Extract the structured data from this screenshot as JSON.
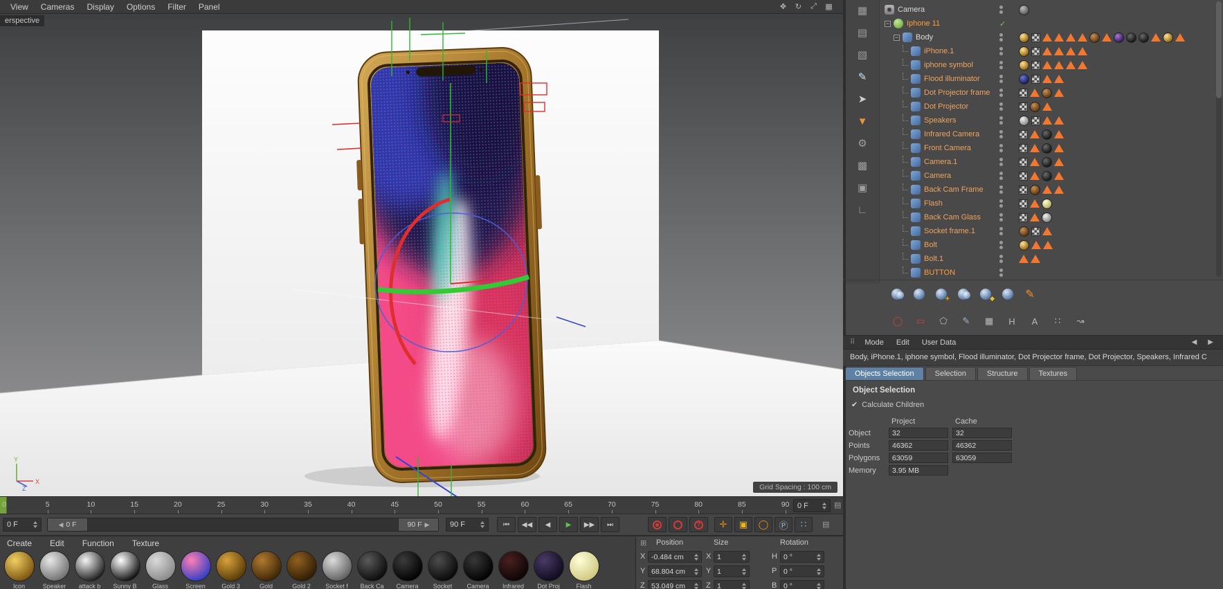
{
  "colors": {
    "accent_orange": "#f08a1a",
    "selected_text_orange": "#ff9d3c",
    "tab_active_blue": "#5e81a4",
    "play_green": "#5ec14e",
    "record_red": "#d23b3b",
    "gizmo_green": "#35c935",
    "gizmo_red": "#df2e2e",
    "gizmo_blue": "#4d5dd8"
  },
  "menubar": {
    "items": [
      "View",
      "Cameras",
      "Display",
      "Options",
      "Filter",
      "Panel"
    ],
    "viewport_controls": [
      {
        "name": "pan-view-icon",
        "glyph": "✥"
      },
      {
        "name": "orbit-view-icon",
        "glyph": "↻"
      },
      {
        "name": "zoom-view-icon",
        "glyph": "⤢"
      },
      {
        "name": "toggle-view-icon",
        "glyph": "▦"
      }
    ]
  },
  "viewport": {
    "view_label": "erspective",
    "grid_spacing_label": "Grid Spacing : 100 cm",
    "axis_x": "X",
    "axis_y": "Y",
    "axis_z": "Z"
  },
  "timeline": {
    "ruler_ticks": [
      "0",
      "5",
      "10",
      "15",
      "20",
      "25",
      "30",
      "35",
      "40",
      "45",
      "50",
      "55",
      "60",
      "65",
      "70",
      "75",
      "80",
      "85",
      "90"
    ],
    "current_frame_field": "0 F",
    "frame_combo": "0 F",
    "range_start_label": "0 F",
    "range_end_label": "90 F",
    "end_frame_field": "90 F",
    "transport_buttons": [
      {
        "name": "goto-start-button",
        "glyph": "⏮"
      },
      {
        "name": "prev-key-button",
        "glyph": "◀◀"
      },
      {
        "name": "prev-frame-button",
        "glyph": "◀"
      },
      {
        "name": "play-button",
        "glyph": "▶",
        "color": "#5ec14e"
      },
      {
        "name": "next-frame-button",
        "glyph": "▶▶"
      },
      {
        "name": "goto-end-button",
        "glyph": "⏭"
      }
    ],
    "record_buttons": [
      {
        "name": "record-keyframe-button",
        "style": "dot"
      },
      {
        "name": "autokey-button",
        "style": "ring"
      },
      {
        "name": "keyframe-selection-button",
        "style": "question"
      }
    ],
    "record_toggles": [
      {
        "name": "record-position-toggle",
        "glyph": "✛",
        "color": "#f08a1a"
      },
      {
        "name": "record-scale-toggle",
        "glyph": "▣",
        "color": "#f0b31a"
      },
      {
        "name": "record-rotation-toggle",
        "glyph": "◯",
        "color": "#f08a1a"
      },
      {
        "name": "record-parameter-toggle",
        "glyph": "Ⓟ",
        "color": "#9fb6d8"
      },
      {
        "name": "record-pla-toggle",
        "glyph": "∷",
        "color": "#8fa8e8"
      }
    ]
  },
  "materials": {
    "menu_items": [
      "Create",
      "Edit",
      "Function",
      "Texture"
    ],
    "items": [
      {
        "name": "Icon",
        "c1": "#f2cf63",
        "c2": "#7a5310"
      },
      {
        "name": "Speaker",
        "c1": "#e8e8e8",
        "c2": "#6f6f6f"
      },
      {
        "name": "attack b",
        "c1": "#f5f5f5",
        "c2": "#1c1c1c"
      },
      {
        "name": "Sunny B",
        "c1": "#ffffff",
        "c2": "#0d0d0d"
      },
      {
        "name": "Glass",
        "c1": "#d9d9d9",
        "c2": "#8a8a8a"
      },
      {
        "name": "Screen",
        "c1": "#ff7fb3",
        "c2": "#2f3ec4"
      },
      {
        "name": "Gold 3",
        "c1": "#d8a23c",
        "c2": "#573a06"
      },
      {
        "name": "Gold",
        "c1": "#b07a30",
        "c2": "#3d2506"
      },
      {
        "name": "Gold 2",
        "c1": "#91601f",
        "c2": "#2e1c05"
      },
      {
        "name": "Socket f",
        "c1": "#dcdcdc",
        "c2": "#5e5e5e"
      },
      {
        "name": "Back Ca",
        "c1": "#5a5a5a",
        "c2": "#0a0a0a"
      },
      {
        "name": "Camera",
        "c1": "#3c3c3c",
        "c2": "#000000"
      },
      {
        "name": "Socket",
        "c1": "#4d4d4d",
        "c2": "#070707"
      },
      {
        "name": "Camera",
        "c1": "#383838",
        "c2": "#000000"
      },
      {
        "name": "Infrared",
        "c1": "#4a2020",
        "c2": "#0c0404"
      },
      {
        "name": "Dot Proj",
        "c1": "#4a3a66",
        "c2": "#0e0a1c"
      },
      {
        "name": "Flash",
        "c1": "#ffffd9",
        "c2": "#cfc67e"
      }
    ]
  },
  "coordinates": {
    "column_headers": [
      "Position",
      "Size",
      "Rotation"
    ],
    "rows": [
      {
        "axis": "X",
        "position": "-0.484 cm",
        "size_axis": "X",
        "size": "1",
        "rot_axis": "H",
        "rotation": "0 °"
      },
      {
        "axis": "Y",
        "position": "68.804 cm",
        "size_axis": "Y",
        "size": "1",
        "rot_axis": "P",
        "rotation": "0 °"
      },
      {
        "axis": "Z",
        "position": "53.049 cm",
        "size_axis": "Z",
        "size": "1",
        "rot_axis": "B",
        "rotation": "0 °"
      }
    ]
  },
  "right_panel": {
    "toolbar_icons": [
      {
        "name": "array-objects-icon",
        "glyph": "▦"
      },
      {
        "name": "duplicate-objects-icon",
        "glyph": "▤"
      },
      {
        "name": "group-objects-icon",
        "glyph": "▧"
      },
      {
        "name": "pen-tool-icon",
        "glyph": "✎",
        "color": "#cfe0f2"
      },
      {
        "name": "pick-tool-icon",
        "glyph": "➤",
        "color": "#d0d0d0"
      },
      {
        "name": "drop-to-floor-icon",
        "glyph": "▼",
        "color": "#e8923a"
      },
      {
        "name": "layer-settings-icon",
        "glyph": "⚙"
      },
      {
        "name": "grid-array-icon",
        "glyph": "▩"
      },
      {
        "name": "texture-view-icon",
        "glyph": "▣"
      },
      {
        "name": "axis-mode-icon",
        "glyph": "∟"
      }
    ],
    "palette_spheres": [
      {
        "name": "material-sphere-icon",
        "style": "pair"
      },
      {
        "name": "shader-sphere-icon",
        "style": "single"
      },
      {
        "name": "add-material-icon",
        "style": "plus"
      },
      {
        "name": "material-pair-icon",
        "style": "pair"
      },
      {
        "name": "key-material-icon",
        "style": "key"
      },
      {
        "name": "bake-material-icon",
        "style": "single"
      },
      {
        "name": "paint-brush-icon",
        "style": "brush"
      }
    ],
    "palette_tools": [
      {
        "name": "red-circle-tool-icon",
        "glyph": "◯",
        "color": "#d04040"
      },
      {
        "name": "red-rect-tool-icon",
        "glyph": "▭",
        "color": "#d04040"
      },
      {
        "name": "lasso-tool-icon",
        "glyph": "⬠"
      },
      {
        "name": "poly-pen-icon",
        "glyph": "✎",
        "color": "#9fb6cc"
      },
      {
        "name": "cube-tool-icon",
        "glyph": "▦"
      },
      {
        "name": "h-tool-icon",
        "glyph": "H"
      },
      {
        "name": "a-tool-icon",
        "glyph": "A"
      },
      {
        "name": "dots-tool-icon",
        "glyph": "∷"
      },
      {
        "name": "spline-tool-icon",
        "glyph": "↝"
      }
    ]
  },
  "object_manager": {
    "items": [
      {
        "name": "Camera",
        "level": 0,
        "color": "#d9d9d9",
        "icon": "camera",
        "expander": null,
        "dots": true,
        "tags": [
          "gray"
        ]
      },
      {
        "name": "Iphone 11",
        "level": 0,
        "color": "#ff9d3c",
        "icon": "null",
        "expander": "minus",
        "dots": "check",
        "tags": []
      },
      {
        "name": "Body",
        "level": 1,
        "color": "#dcdcdc",
        "icon": "mesh",
        "expander": "minus",
        "dots": true,
        "tags": [
          "gold",
          "checker",
          "tri",
          "tri",
          "tri",
          "tri",
          "brown",
          "tri",
          "purple",
          "dark",
          "dark",
          "tri",
          "gold",
          "tri"
        ]
      },
      {
        "name": "iPhone.1",
        "level": 2,
        "color": "#f0a35c",
        "icon": "mesh",
        "expander": null,
        "dots": true,
        "tags": [
          "gold",
          "checker",
          "tri",
          "tri",
          "tri",
          "tri"
        ]
      },
      {
        "name": "iphone symbol",
        "level": 2,
        "color": "#f0a35c",
        "icon": "mesh",
        "expander": null,
        "dots": true,
        "tags": [
          "gold",
          "checker",
          "tri",
          "tri",
          "tri",
          "tri"
        ]
      },
      {
        "name": "Flood illuminator",
        "level": 2,
        "color": "#f0a35c",
        "icon": "mesh",
        "expander": null,
        "dots": true,
        "tags": [
          "navy",
          "checker",
          "tri",
          "tri"
        ]
      },
      {
        "name": "Dot Projector frame",
        "level": 2,
        "color": "#f0a35c",
        "icon": "mesh",
        "expander": null,
        "dots": true,
        "tags": [
          "checker",
          "tri",
          "brown",
          "tri"
        ]
      },
      {
        "name": "Dot Projector",
        "level": 2,
        "color": "#f0a35c",
        "icon": "mesh",
        "expander": null,
        "dots": true,
        "tags": [
          "checker",
          "brown",
          "tri"
        ]
      },
      {
        "name": "Speakers",
        "level": 2,
        "color": "#f0a35c",
        "icon": "mesh",
        "expander": null,
        "dots": true,
        "tags": [
          "silver",
          "checker",
          "tri",
          "tri"
        ]
      },
      {
        "name": "Infrared Camera",
        "level": 2,
        "color": "#f0a35c",
        "icon": "mesh",
        "expander": null,
        "dots": true,
        "tags": [
          "checker",
          "tri",
          "dark",
          "tri"
        ]
      },
      {
        "name": "Front Camera",
        "level": 2,
        "color": "#f0a35c",
        "icon": "mesh",
        "expander": null,
        "dots": true,
        "tags": [
          "checker",
          "tri",
          "dark",
          "tri"
        ]
      },
      {
        "name": "Camera.1",
        "level": 2,
        "color": "#f0a35c",
        "icon": "mesh",
        "expander": null,
        "dots": true,
        "tags": [
          "checker",
          "tri",
          "dark",
          "tri"
        ]
      },
      {
        "name": "Camera",
        "level": 2,
        "color": "#f0a35c",
        "icon": "mesh",
        "expander": null,
        "dots": true,
        "tags": [
          "checker",
          "tri",
          "dark",
          "tri"
        ]
      },
      {
        "name": "Back Cam Frame",
        "level": 2,
        "color": "#f0a35c",
        "icon": "mesh",
        "expander": null,
        "dots": true,
        "tags": [
          "checker",
          "brown",
          "tri",
          "tri"
        ]
      },
      {
        "name": "Flash",
        "level": 2,
        "color": "#f0a35c",
        "icon": "mesh",
        "expander": null,
        "dots": true,
        "tags": [
          "checker",
          "tri",
          "pale"
        ]
      },
      {
        "name": "Back Cam Glass",
        "level": 2,
        "color": "#f0a35c",
        "icon": "mesh",
        "expander": null,
        "dots": true,
        "tags": [
          "checker",
          "tri",
          "silver"
        ]
      },
      {
        "name": "Socket frame.1",
        "level": 2,
        "color": "#f0a35c",
        "icon": "mesh",
        "expander": null,
        "dots": true,
        "tags": [
          "brown",
          "checker",
          "tri"
        ]
      },
      {
        "name": "Bolt",
        "level": 2,
        "color": "#f0a35c",
        "icon": "mesh",
        "expander": null,
        "dots": true,
        "tags": [
          "gold",
          "tri",
          "tri"
        ]
      },
      {
        "name": "Bolt.1",
        "level": 2,
        "color": "#f0a35c",
        "icon": "mesh",
        "expander": null,
        "dots": true,
        "tags": [
          "tri",
          "tri"
        ]
      },
      {
        "name": "BUTTON",
        "level": 2,
        "color": "#ff9d3c",
        "icon": "mesh",
        "expander": null,
        "dots": true,
        "tags": []
      }
    ]
  },
  "attribute_panel": {
    "mode_menu": [
      "Mode",
      "Edit",
      "User Data"
    ],
    "selection_text": "Body, iPhone.1, iphone symbol, Flood illuminator, Dot Projector frame, Dot Projector, Speakers, Infrared C",
    "tabs": [
      {
        "label": "Objects Selection",
        "active": true
      },
      {
        "label": "Selection",
        "active": false
      },
      {
        "label": "Structure",
        "active": false
      },
      {
        "label": "Textures",
        "active": false
      }
    ],
    "section_title": "Object Selection",
    "checkbox_label": "Calculate Children",
    "table": {
      "col_headers": [
        "Project",
        "Cache"
      ],
      "rows": [
        {
          "label": "Object",
          "project": "32",
          "cache": "32"
        },
        {
          "label": "Points",
          "project": "46362",
          "cache": "46362"
        },
        {
          "label": "Polygons",
          "project": "63059",
          "cache": "63059"
        },
        {
          "label": "Memory",
          "project": "3.95 MB",
          "cache": ""
        }
      ]
    }
  }
}
